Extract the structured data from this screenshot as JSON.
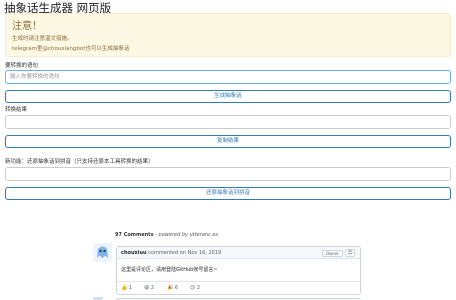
{
  "page": {
    "title": "抽象话生成器 网页版"
  },
  "alert": {
    "heading": "注意！",
    "line1": "生成时请注意温文措施。",
    "line2": "telegram里@chouxiangbot也可以生成抽象话"
  },
  "generate": {
    "label": "要转换的语句",
    "input_placeholder": "输入你要转换的语句",
    "button": "生成抽象话"
  },
  "result": {
    "label": "转换结果",
    "value": "",
    "button": "复制结果"
  },
  "reverse": {
    "label": "新功能：还原抽象话到拼音（只支持还原本工具转换的结果）",
    "value": "",
    "button": "还原抽象话到拼音"
  },
  "comments": {
    "count": "97 Comments",
    "powered": "powered by utteranc.es",
    "comment": {
      "author": "chouxiuu",
      "meta": "commented on Nov 16, 2019",
      "badge": "Owner",
      "body": "这里是评论区，请用登陆GitHub账号留言~",
      "reactions": [
        {
          "emoji": "👍",
          "count": "1"
        },
        {
          "emoji": "😄",
          "count": "2"
        },
        {
          "emoji": "🎉",
          "count": "6"
        },
        {
          "emoji": "😕",
          "count": "2"
        }
      ]
    }
  }
}
